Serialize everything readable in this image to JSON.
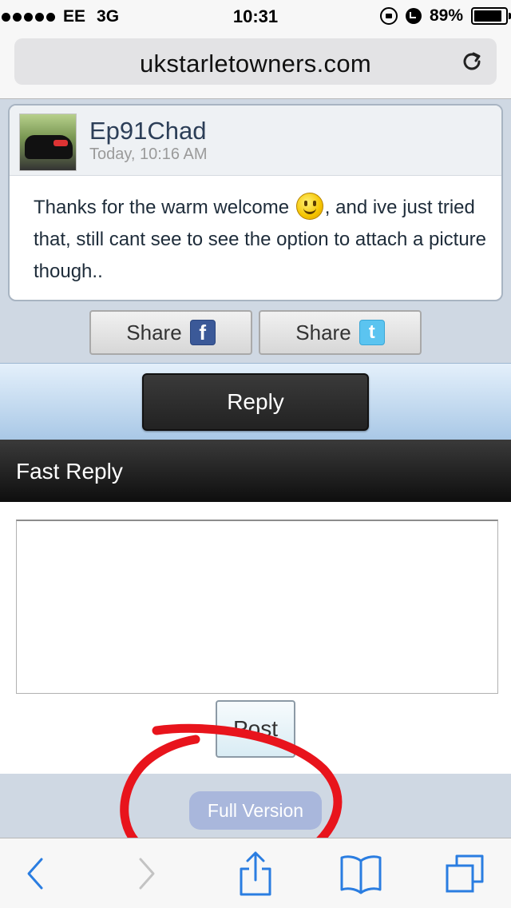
{
  "status_bar": {
    "carrier": "EE",
    "network": "3G",
    "time": "10:31",
    "battery_percent": "89%",
    "battery_level": 0.89,
    "icons": [
      "signal-dots",
      "rotation-lock-icon",
      "alarm-icon",
      "battery-icon"
    ]
  },
  "browser": {
    "url": "ukstarletowners.com",
    "reload_icon": "reload-icon"
  },
  "post": {
    "username": "Ep91Chad",
    "timestamp": "Today, 10:16 AM",
    "body_before_emoji": "Thanks for the warm welcome ",
    "body_after_emoji": ", and ive just tried that, still cant see to see the option to attach a picture though..",
    "emoji": "smiley-icon"
  },
  "share": {
    "facebook_label": "Share",
    "twitter_label": "Share",
    "facebook_icon_glyph": "f",
    "twitter_icon_glyph": "t"
  },
  "reply_button_label": "Reply",
  "fast_reply": {
    "title": "Fast Reply",
    "textarea_value": "",
    "post_button_label": "Post"
  },
  "footer": {
    "full_version_label": "Full Version"
  },
  "colors": {
    "accent_dark": "#222222",
    "full_version_bg": "#a9b7dc",
    "annotation_red": "#e8141c",
    "ios_blue": "#2a7de1"
  },
  "toolbar_icons": [
    "back-icon",
    "forward-icon",
    "share-icon",
    "bookmarks-icon",
    "tabs-icon"
  ]
}
